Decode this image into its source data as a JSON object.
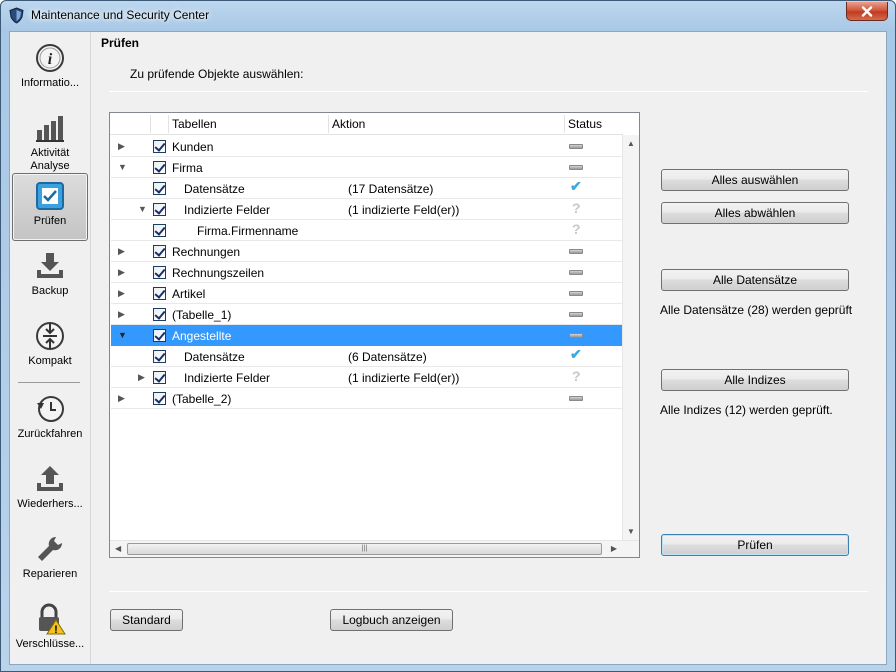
{
  "window": {
    "title": "Maintenance und Security Center"
  },
  "sidebar": {
    "items": [
      {
        "label": "Informatio...",
        "icon": "info-icon"
      },
      {
        "label": "Aktivität Analyse",
        "icon": "bar-chart-icon"
      },
      {
        "label": "Prüfen",
        "icon": "checkbox-icon",
        "active": true
      },
      {
        "label": "Backup",
        "icon": "backup-download-icon"
      },
      {
        "label": "Kompakt",
        "icon": "compact-icon"
      },
      {
        "label": "Zurückfahren",
        "icon": "rollback-clock-icon"
      },
      {
        "label": "Wiederhers...",
        "icon": "restore-upload-icon"
      },
      {
        "label": "Reparieren",
        "icon": "wrench-icon"
      },
      {
        "label": "Verschlüsse...",
        "icon": "lock-warning-icon"
      }
    ]
  },
  "main": {
    "section_title": "Prüfen",
    "subtitle": "Zu prüfende Objekte auswählen:"
  },
  "tree": {
    "columns": [
      "Tabellen",
      "Aktion",
      "Status"
    ],
    "rows": [
      {
        "label": "Kunden",
        "action": "",
        "status": "dash",
        "level": 0,
        "expander": "collapsed",
        "checked": true
      },
      {
        "label": "Firma",
        "action": "",
        "status": "dash",
        "level": 0,
        "expander": "expanded",
        "checked": true
      },
      {
        "label": "Datensätze",
        "action": "(17 Datensätze)",
        "status": "ok",
        "level": 1,
        "expander": "none",
        "checked": true
      },
      {
        "label": "Indizierte Felder",
        "action": "(1 indizierte Feld(er))",
        "status": "unknown",
        "level": 1,
        "expander": "expanded",
        "checked": true
      },
      {
        "label": "Firma.Firmenname",
        "action": "",
        "status": "unknown",
        "level": 2,
        "expander": "none",
        "checked": true
      },
      {
        "label": "Rechnungen",
        "action": "",
        "status": "dash",
        "level": 0,
        "expander": "collapsed",
        "checked": true
      },
      {
        "label": "Rechnungszeilen",
        "action": "",
        "status": "dash",
        "level": 0,
        "expander": "collapsed",
        "checked": true
      },
      {
        "label": "Artikel",
        "action": "",
        "status": "dash",
        "level": 0,
        "expander": "collapsed",
        "checked": true
      },
      {
        "label": "(Tabelle_1)",
        "action": "",
        "status": "dash",
        "level": 0,
        "expander": "collapsed",
        "checked": true
      },
      {
        "label": "Angestellte",
        "action": "",
        "status": "dash",
        "level": 0,
        "expander": "expanded",
        "checked": true,
        "selected": true
      },
      {
        "label": "Datensätze",
        "action": "(6 Datensätze)",
        "status": "ok",
        "level": 1,
        "expander": "none",
        "checked": true
      },
      {
        "label": "Indizierte Felder",
        "action": "(1 indizierte Feld(er))",
        "status": "unknown",
        "level": 1,
        "expander": "collapsed",
        "checked": true
      },
      {
        "label": "(Tabelle_2)",
        "action": "",
        "status": "dash",
        "level": 0,
        "expander": "collapsed",
        "checked": true
      }
    ]
  },
  "buttons": {
    "select_all": "Alles auswählen",
    "deselect_all": "Alles abwählen",
    "all_records": "Alle Datensätze",
    "all_indexes": "Alle Indizes",
    "check": "Prüfen",
    "standard": "Standard",
    "show_log": "Logbuch anzeigen"
  },
  "info": {
    "records_note": "Alle Datensätze (28) werden geprüft",
    "indexes_note": "Alle Indizes (12) werden geprüft."
  },
  "colors": {
    "selection": "#3399ff",
    "ok_check": "#3da7e6",
    "close_button": "#c23b1f"
  }
}
